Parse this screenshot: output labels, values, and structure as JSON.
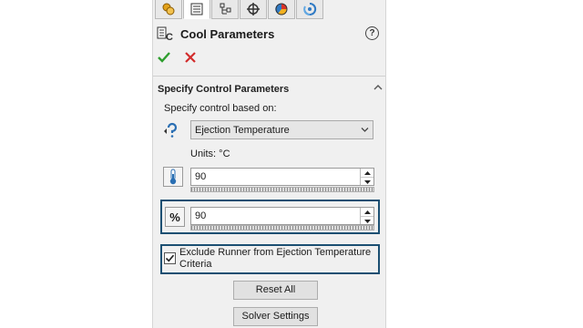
{
  "tabs": [
    {
      "icon": "feature-manager-icon"
    },
    {
      "icon": "property-manager-icon",
      "active": true
    },
    {
      "icon": "configuration-manager-icon"
    },
    {
      "icon": "dimxpert-icon"
    },
    {
      "icon": "display-manager-icon"
    },
    {
      "icon": "simulation-icon"
    }
  ],
  "header": {
    "title": "Cool Parameters"
  },
  "group": {
    "title": "Specify Control Parameters",
    "control_label": "Specify control based on:",
    "control_value": "Ejection Temperature",
    "units_label": "Units: °C",
    "temperature_value": "90",
    "percent_label": "%",
    "percent_value": "90",
    "exclude_runner_label": "Exclude Runner from Ejection Temperature Criteria",
    "exclude_runner_checked": true,
    "reset_button": "Reset All",
    "solver_button": "Solver Settings"
  },
  "colors": {
    "ok": "#2e9e2e",
    "cancel": "#d22b2b",
    "highlight": "#1b4f72"
  }
}
